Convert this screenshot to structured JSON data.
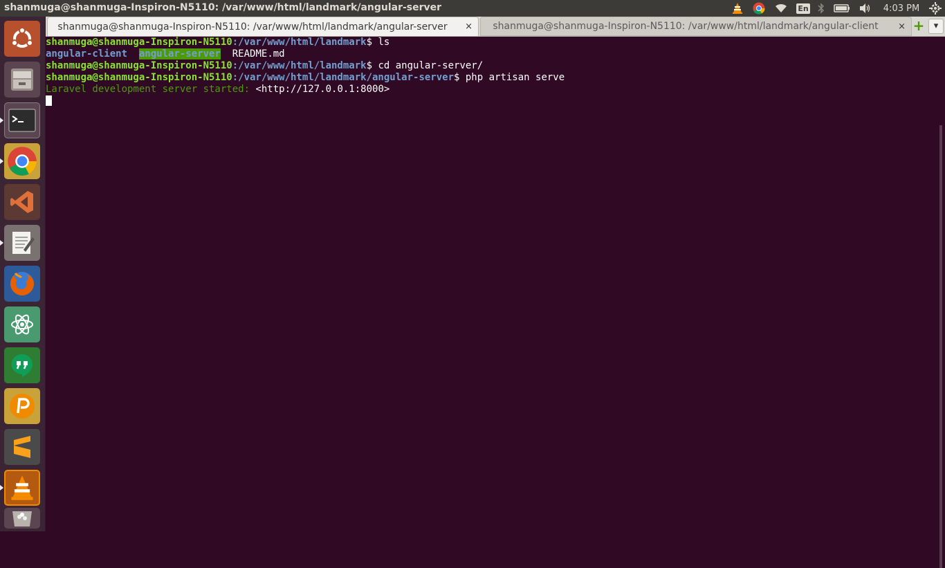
{
  "window": {
    "title": "shanmuga@shanmuga-Inspiron-N5110: /var/www/html/landmark/angular-server"
  },
  "tray": {
    "keyboard_layout": "En",
    "clock": "4:03 PM",
    "icons": [
      "vlc-icon",
      "chrome-icon",
      "wifi-icon",
      "keyboard-icon",
      "bluetooth-icon",
      "battery-icon",
      "volume-icon",
      "settings-gear-icon"
    ]
  },
  "launcher": {
    "items": [
      {
        "name": "ubuntu-dash-icon"
      },
      {
        "name": "files-icon"
      },
      {
        "name": "terminal-icon"
      },
      {
        "name": "chrome-icon"
      },
      {
        "name": "visual-studio-code-icon"
      },
      {
        "name": "text-editor-icon"
      },
      {
        "name": "firefox-icon"
      },
      {
        "name": "atom-icon"
      },
      {
        "name": "hangouts-icon"
      },
      {
        "name": "pushbullet-icon"
      },
      {
        "name": "sublime-text-icon"
      },
      {
        "name": "vlc-icon"
      },
      {
        "name": "trash-icon"
      }
    ],
    "colors": {
      "background": "#3b2433"
    }
  },
  "tabs": [
    {
      "label": "shanmuga@shanmuga-Inspiron-N5110: /var/www/html/landmark/angular-server",
      "close": "×",
      "active": true
    },
    {
      "label": "shanmuga@shanmuga-Inspiron-N5110: /var/www/html/landmark/angular-client",
      "close": "×",
      "active": false
    }
  ],
  "new_tab": "+",
  "tab_menu": "▾",
  "terminal": {
    "colors": {
      "background": "#300a24",
      "prompt_user": "#8ae234",
      "prompt_path": "#729fcf",
      "info": "#4e9a06"
    },
    "line1": {
      "user": "shanmuga@shanmuga-Inspiron-N5110",
      "path": ":/var/www/html/landmark",
      "cmd": "$ ls"
    },
    "line2": {
      "dir1": "angular-client",
      "dir2": "angular-server",
      "file": "README.md"
    },
    "line3": {
      "user": "shanmuga@shanmuga-Inspiron-N5110",
      "path": ":/var/www/html/landmark",
      "cmd": "$ cd angular-server/"
    },
    "line4": {
      "user": "shanmuga@shanmuga-Inspiron-N5110",
      "path": ":/var/www/html/landmark/angular-server",
      "cmd": "$ php artisan serve"
    },
    "line5": {
      "msg": "Laravel development server started:",
      "url": " <http://127.0.0.1:8000>"
    }
  }
}
